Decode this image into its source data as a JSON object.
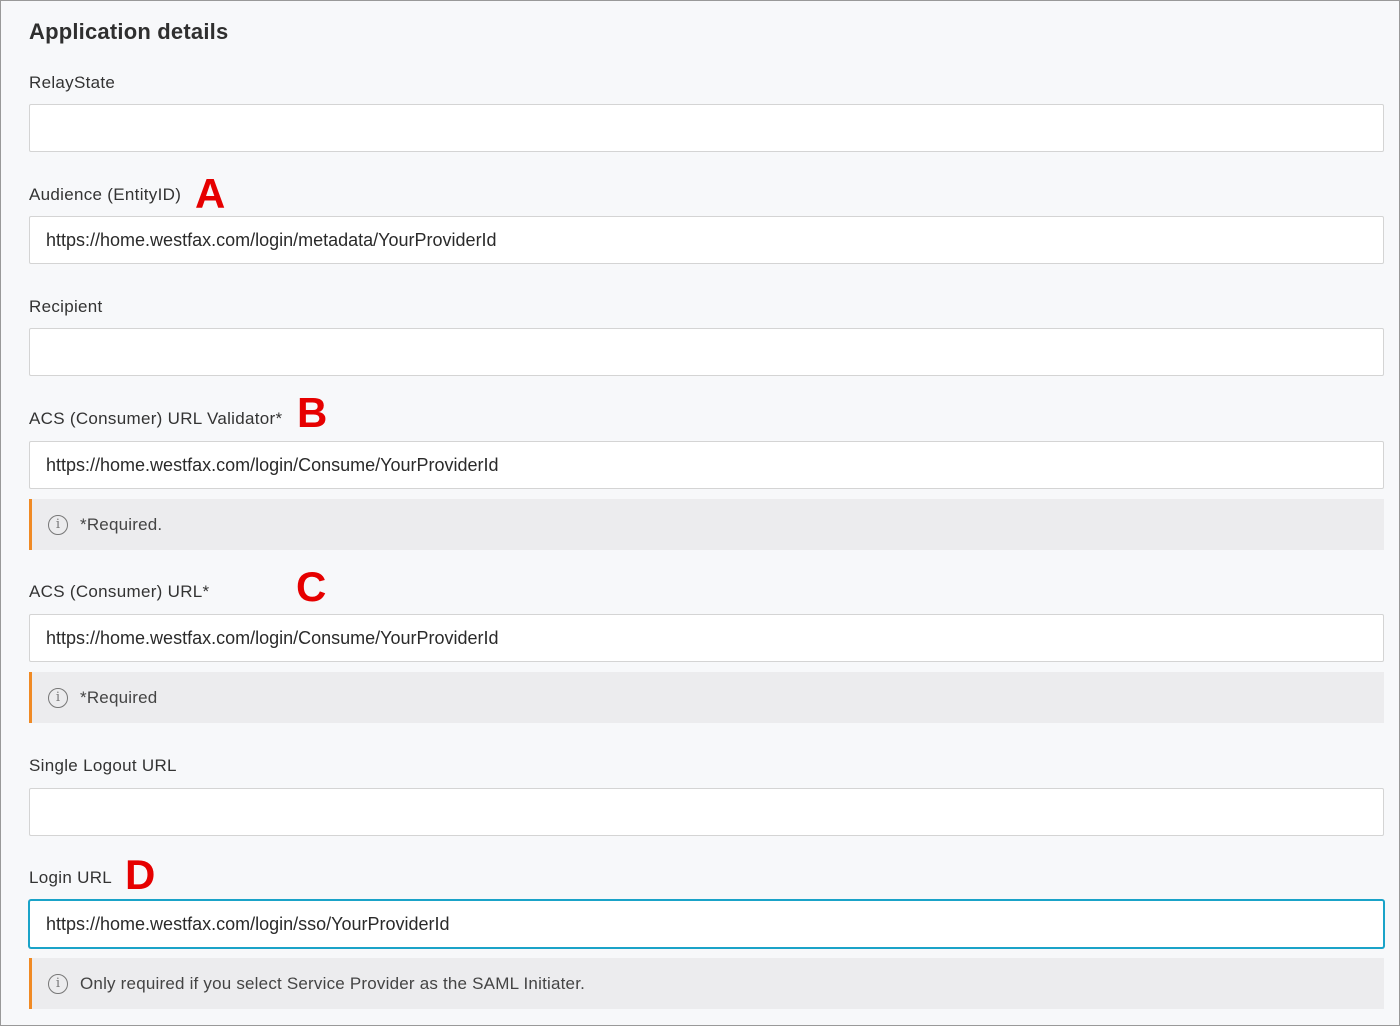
{
  "section": {
    "title": "Application details"
  },
  "fields": {
    "relay_state": {
      "label": "RelayState",
      "value": ""
    },
    "audience": {
      "label": "Audience (EntityID)",
      "value": "https://home.westfax.com/login/metadata/YourProviderId",
      "marker": "A"
    },
    "recipient": {
      "label": "Recipient",
      "value": ""
    },
    "acs_validator": {
      "label": "ACS (Consumer) URL Validator*",
      "value": "https://home.westfax.com/login/Consume/YourProviderId",
      "marker": "B",
      "note": "*Required."
    },
    "acs_url": {
      "label": "ACS (Consumer) URL*",
      "value": "https://home.westfax.com/login/Consume/YourProviderId",
      "marker": "C",
      "note": "*Required"
    },
    "single_logout": {
      "label": "Single Logout URL",
      "value": ""
    },
    "login_url": {
      "label": "Login URL",
      "value": "https://home.westfax.com/login/sso/YourProviderId",
      "marker": "D",
      "note": "Only required if you select Service Provider as the SAML Initiater."
    }
  },
  "icons": {
    "info_glyph": "i"
  },
  "colors": {
    "marker": "#e60000",
    "note_accent": "#f08a24",
    "focus_border": "#1aa3c8"
  }
}
